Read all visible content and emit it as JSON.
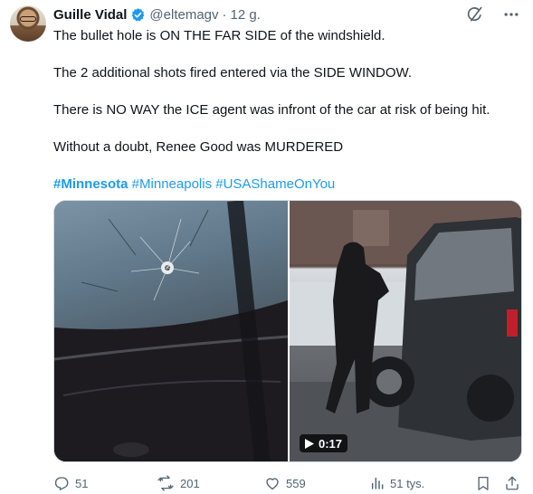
{
  "author": {
    "name": "Guille Vidal",
    "handle": "@eltemagv",
    "separator": "·",
    "time": "12 g."
  },
  "tweet": {
    "paragraphs": [
      "The bullet hole is ON THE FAR SIDE of the windshield.",
      "The 2 additional shots fired entered via the SIDE WINDOW.",
      "There is NO WAY the ICE agent was infront of the car at risk of being hit.",
      "Without a doubt, Renee Good was MURDERED"
    ],
    "hashtag_bold": "#Minnesota",
    "hashtags_rest": " #Minneapolis #USAShameOnYou"
  },
  "media": {
    "video_duration": "0:17"
  },
  "actions": {
    "replies": "51",
    "reposts": "201",
    "likes": "559",
    "views": "51 tys."
  },
  "colors": {
    "accent": "#1d9bf0",
    "text": "#0f1419",
    "secondary": "#536471"
  },
  "icons": [
    "verified-icon",
    "grok-icon",
    "more-icon",
    "reply-icon",
    "repost-icon",
    "like-icon",
    "views-icon",
    "bookmark-icon",
    "share-icon",
    "play-icon"
  ]
}
